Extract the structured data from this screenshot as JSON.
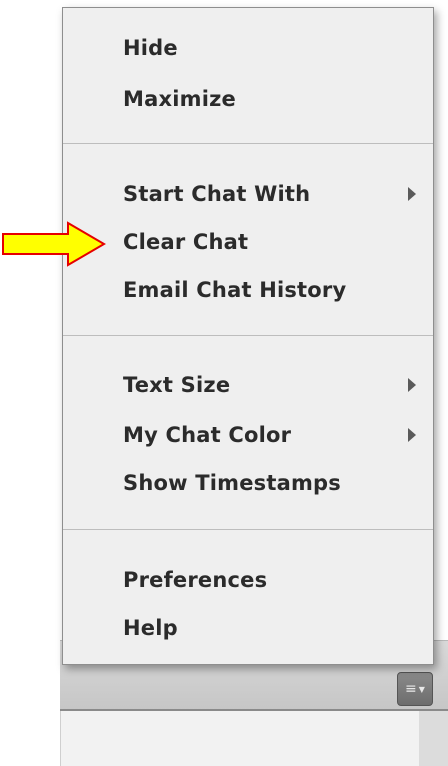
{
  "menu": {
    "groups": [
      {
        "items": [
          {
            "label": "Hide",
            "has_submenu": false
          },
          {
            "label": "Maximize",
            "has_submenu": false
          }
        ]
      },
      {
        "items": [
          {
            "label": "Start Chat With",
            "has_submenu": true
          },
          {
            "label": "Clear Chat",
            "has_submenu": false
          },
          {
            "label": "Email Chat History",
            "has_submenu": false
          }
        ]
      },
      {
        "items": [
          {
            "label": "Text Size",
            "has_submenu": true
          },
          {
            "label": "My Chat Color",
            "has_submenu": true
          },
          {
            "label": "Show Timestamps",
            "has_submenu": false
          }
        ]
      },
      {
        "items": [
          {
            "label": "Preferences",
            "has_submenu": false
          },
          {
            "label": "Help",
            "has_submenu": false
          }
        ]
      }
    ]
  },
  "pod_options_button": {
    "icon": "list-icon"
  },
  "annotation": {
    "icon": "arrow-right-icon",
    "points_to": "Clear Chat",
    "fill": "#ffff00",
    "stroke": "#e60000"
  },
  "colors": {
    "menu_background": "#efefef",
    "menu_text": "#2b2b2b",
    "button_background": "#7a7a7a"
  }
}
